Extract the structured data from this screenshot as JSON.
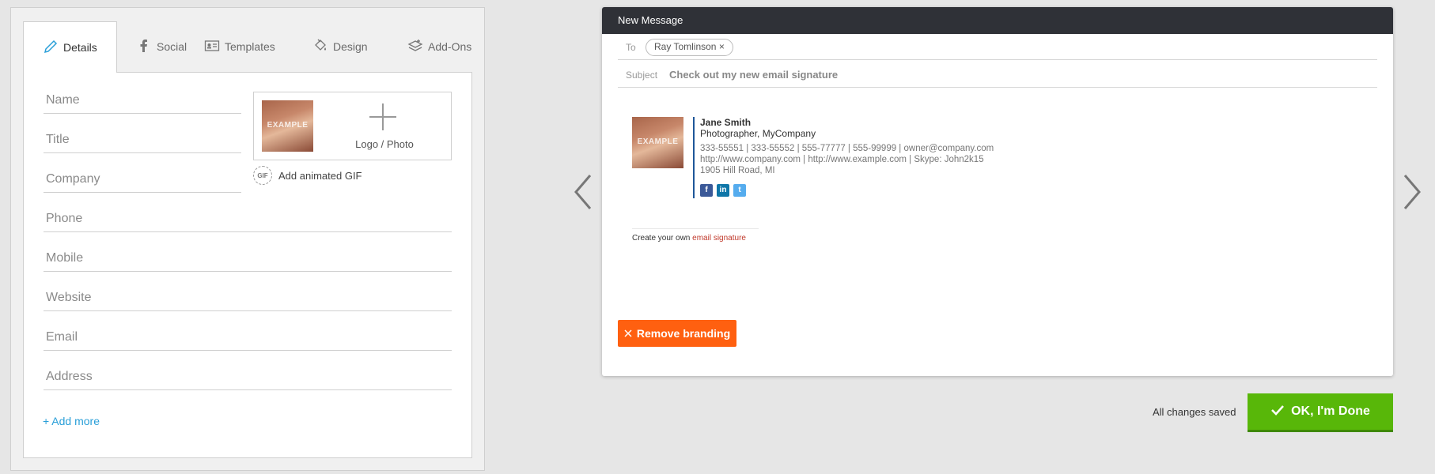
{
  "tabs": [
    {
      "label": "Details",
      "icon": "pencil-icon",
      "active": true
    },
    {
      "label": "Social",
      "icon": "facebook-icon"
    },
    {
      "label": "Templates",
      "icon": "id-card-icon"
    },
    {
      "label": "Design",
      "icon": "paint-bucket-icon"
    },
    {
      "label": "Add-Ons",
      "icon": "layers-icon"
    }
  ],
  "form": {
    "placeholders": [
      "Name",
      "Title",
      "Company",
      "Phone",
      "Mobile",
      "Website",
      "Email",
      "Address"
    ],
    "logo_label": "Logo / Photo",
    "example_watermark": "EXAMPLE",
    "gif_badge": "GIF",
    "gif_label": "Add animated GIF",
    "add_more": "+ Add more"
  },
  "email": {
    "window_title": "New Message",
    "to_label": "To",
    "recipient": "Ray Tomlinson ×",
    "subject_label": "Subject",
    "subject": "Check out my new email signature",
    "signature": {
      "name": "Jane Smith",
      "role": "Photographer, MyCompany",
      "line1": "333-55551 | 333-55552 | 555-77777 | 555-99999 | owner@company.com",
      "line2": "http://www.company.com | http://www.example.com | Skype: John2k15",
      "line3": "1905 Hill Road, MI",
      "social": [
        "f",
        "in",
        "t"
      ]
    },
    "create_own_prefix": "Create your own ",
    "create_own_link": "email signature",
    "remove_branding": "Remove branding"
  },
  "footer": {
    "saved_status": "All changes saved",
    "done_label": "OK, I'm Done"
  },
  "colors": {
    "accent_orange": "#ff6010",
    "done_green": "#58b709",
    "header_dark": "#2f3137",
    "link_blue": "#2a9fd8"
  }
}
